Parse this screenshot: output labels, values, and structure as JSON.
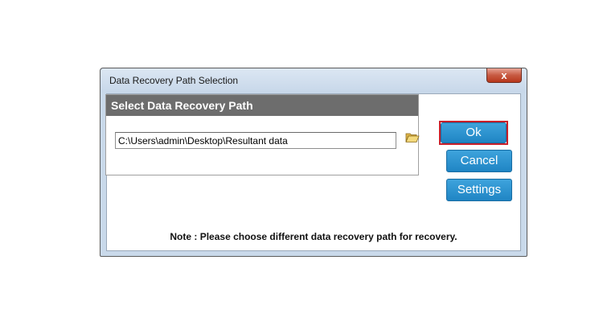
{
  "window": {
    "title": "Data Recovery Path Selection",
    "close_label": "x"
  },
  "group": {
    "header": "Select Data Recovery Path",
    "path_value": "C:\\Users\\admin\\Desktop\\Resultant data"
  },
  "buttons": {
    "ok_label": "Ok",
    "cancel_label": "Cancel",
    "settings_label": "Settings"
  },
  "note": "Note : Please choose different data recovery path for recovery.",
  "colors": {
    "accent_button": "#2a93d2",
    "focus_border": "#c8202b",
    "group_header": "#6d6d6d"
  },
  "icons": {
    "folder": "folder-open-icon",
    "close": "close-icon"
  }
}
